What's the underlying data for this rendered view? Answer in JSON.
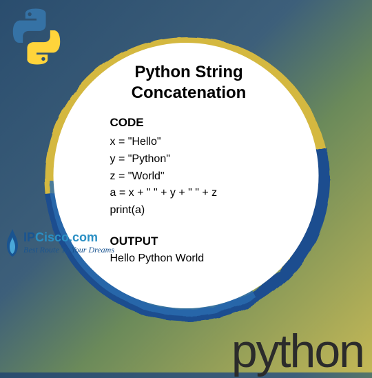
{
  "title_line1": "Python String",
  "title_line2": "Concatenation",
  "code_label": "CODE",
  "code_lines": [
    "x = \"Hello\"",
    "y = \"Python\"",
    "z = \"World\"",
    "a = x + \" \" + y + \" \" + z",
    "print(a)"
  ],
  "output_label": "OUTPUT",
  "output_text": "Hello Python World",
  "ipcisco_name_ip": "IP",
  "ipcisco_name_cisco": "Cisco.com",
  "ipcisco_tagline": "Best Route To Your Dreams",
  "python_word": "python",
  "colors": {
    "python_blue": "#3572A5",
    "python_yellow": "#FFD43B",
    "brush_blue": "#1a4d8f",
    "brush_yellow": "#d4b840"
  }
}
